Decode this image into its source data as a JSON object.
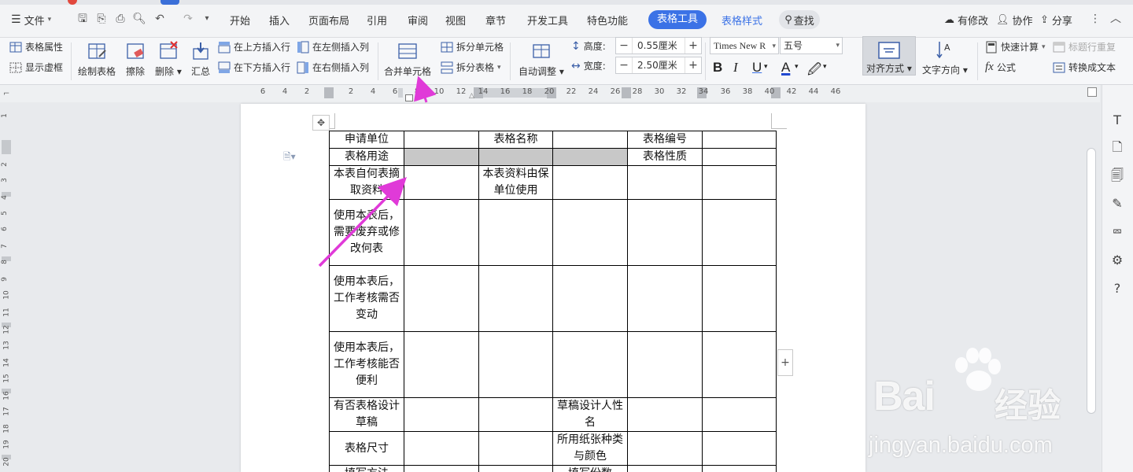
{
  "menubar": {
    "file_label": "文件",
    "items": [
      "开始",
      "插入",
      "页面布局",
      "引用",
      "审阅",
      "视图",
      "章节",
      "开发工具",
      "特色功能"
    ],
    "active_tab": "表格工具",
    "extra_tab": "表格样式",
    "search_label": "查找",
    "modified_label": "有修改",
    "collab_label": "协作",
    "share_label": "分享"
  },
  "ribbon": {
    "table_props": "表格属性",
    "show_gridlines": "显示虚框",
    "draw_table": "绘制表格",
    "erase": "擦除",
    "delete": "删除",
    "summary": "汇总",
    "insert_above": "在上方插入行",
    "insert_below": "在下方插入行",
    "insert_left": "在左侧插入列",
    "insert_right": "在右侧插入列",
    "merge_cells": "合并单元格",
    "split_cells": "拆分单元格",
    "split_table": "拆分表格",
    "auto_fit": "自动调整",
    "height_label": "高度:",
    "height_value": "0.55厘米",
    "width_label": "宽度:",
    "width_value": "2.50厘米",
    "font_name": "Times New R",
    "font_size": "五号",
    "align_label": "对齐方式",
    "text_direction": "文字方向",
    "quick_calc": "快速计算",
    "formula": "公式",
    "repeat_header": "标题行重复",
    "convert_text": "转换成文本"
  },
  "ruler": {
    "labels": [
      "6",
      "4",
      "2",
      "2",
      "4",
      "6",
      "8",
      "10",
      "12",
      "14",
      "16",
      "18",
      "20",
      "22",
      "24",
      "26",
      "28",
      "30",
      "32",
      "34",
      "36",
      "38",
      "40",
      "42",
      "44",
      "46"
    ]
  },
  "vruler": {
    "labels": [
      "1",
      "2",
      "3",
      "4",
      "5",
      "6",
      "7",
      "8",
      "9",
      "10",
      "11",
      "12",
      "13",
      "14",
      "15",
      "16",
      "17",
      "18",
      "19",
      "20"
    ]
  },
  "table": {
    "rows": [
      [
        "申请单位",
        "",
        "表格名称",
        "",
        "表格编号",
        ""
      ],
      [
        "表格用途",
        "",
        "",
        "",
        "表格性质",
        ""
      ],
      [
        "本表自何表摘取资料",
        "",
        "本表资料由保单位使用",
        "",
        "",
        ""
      ],
      [
        "使用本表后，需要废弃或修改何表",
        "",
        "",
        "",
        "",
        ""
      ],
      [
        "使用本表后，工作考核需否变动",
        "",
        "",
        "",
        "",
        ""
      ],
      [
        "使用本表后，工作考核能否便利",
        "",
        "",
        "",
        "",
        ""
      ],
      [
        "有否表格设计草稿",
        "",
        "",
        "草稿设计人性名",
        "",
        ""
      ],
      [
        "表格尺寸",
        "",
        "",
        "所用纸张种类与颜色",
        "",
        ""
      ],
      [
        "填写方法",
        "",
        "",
        "填写份数",
        "",
        ""
      ]
    ],
    "selected": [
      [
        1,
        1
      ],
      [
        1,
        2
      ],
      [
        1,
        3
      ]
    ]
  },
  "watermark": {
    "brand": "Bai",
    "brand_cn": "经验",
    "url": "jingyan.baidu.com"
  },
  "colors": {
    "accent": "#3b72e6",
    "annotation_arrow": "#e03ad8",
    "selection": "#c8c8c8"
  }
}
